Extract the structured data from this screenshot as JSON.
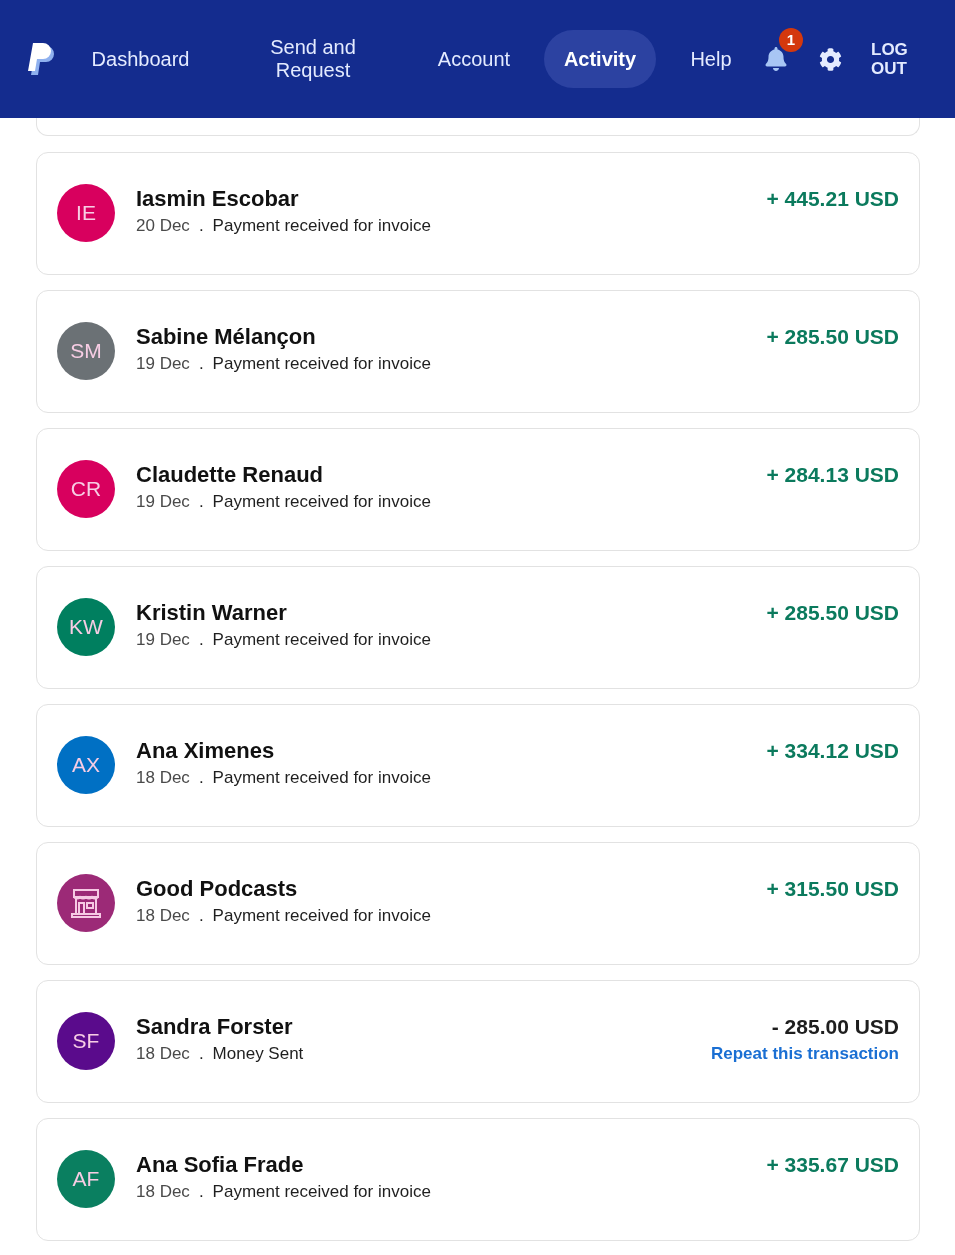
{
  "header": {
    "nav": [
      {
        "label": "Dashboard",
        "selected": false
      },
      {
        "label": "Send and Request",
        "selected": false
      },
      {
        "label": "Account",
        "selected": false
      },
      {
        "label": "Activity",
        "selected": true
      },
      {
        "label": "Help",
        "selected": false
      }
    ],
    "notifications": {
      "badge": "1"
    },
    "logout": "LOG OUT"
  },
  "transactions": [
    {
      "kind": "initials",
      "initials": "IE",
      "color": "#d8005e",
      "name": "Iasmin Escobar",
      "date": "20 Dec",
      "separator": ".",
      "description": "Payment received for invoice",
      "received": true,
      "amount": "+ 445.21 USD"
    },
    {
      "kind": "initials",
      "initials": "SM",
      "color": "#6b7175",
      "name": "Sabine Mélançon",
      "date": "19 Dec",
      "separator": ".",
      "description": "Payment received for invoice",
      "received": true,
      "amount": "+ 285.50 USD"
    },
    {
      "kind": "initials",
      "initials": "CR",
      "color": "#d8005e",
      "name": "Claudette Renaud",
      "date": "19 Dec",
      "separator": ".",
      "description": "Payment received for invoice",
      "received": true,
      "amount": "+ 284.13 USD"
    },
    {
      "kind": "initials",
      "initials": "KW",
      "color": "#007f5f",
      "name": "Kristin Warner",
      "date": "19 Dec",
      "separator": ".",
      "description": "Payment received for invoice",
      "received": true,
      "amount": "+ 285.50 USD"
    },
    {
      "kind": "initials",
      "initials": "AX",
      "color": "#0070c4",
      "name": "Ana Ximenes",
      "date": "18 Dec",
      "separator": ".",
      "description": "Payment received for invoice",
      "received": true,
      "amount": "+ 334.12 USD"
    },
    {
      "kind": "merchant",
      "color": "#9c2a77",
      "name": "Good Podcasts",
      "date": "18 Dec",
      "separator": ".",
      "description": "Payment received for invoice",
      "received": true,
      "amount": "+ 315.50 USD"
    },
    {
      "kind": "initials",
      "initials": "SF",
      "color": "#5a0b8c",
      "name": "Sandra Forster",
      "date": "18 Dec",
      "separator": ".",
      "description": "Money Sent",
      "received": false,
      "amount": "- 285.00 USD",
      "action_link": "Repeat this transaction"
    },
    {
      "kind": "initials",
      "initials": "AF",
      "color": "#0a7f60",
      "name": "Ana Sofia Frade",
      "date": "18 Dec",
      "separator": ".",
      "description": "Payment received for invoice",
      "received": true,
      "amount": "+ 335.67 USD"
    }
  ]
}
